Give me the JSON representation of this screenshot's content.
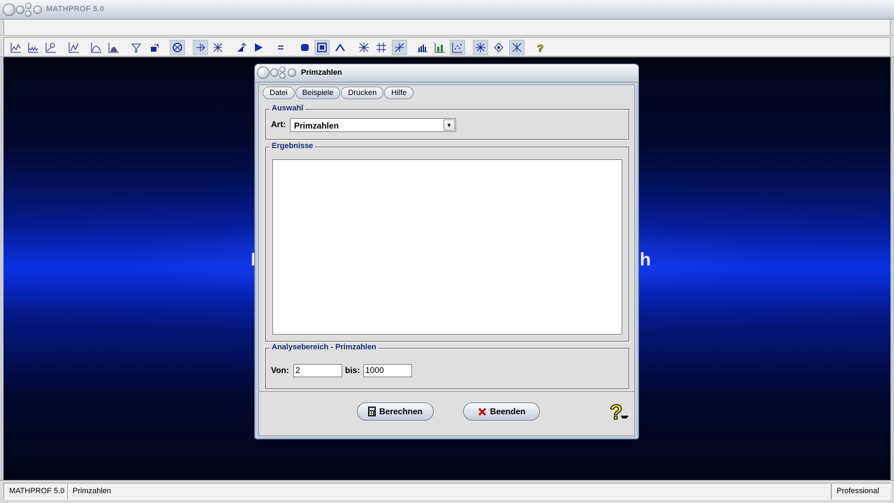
{
  "app": {
    "title": "MATHPROF 5.0"
  },
  "toolbar": {
    "icons": [
      "function-plot-icon",
      "multi-plot-icon",
      "curve-analysis-icon",
      "derivative-plot-icon",
      "integral-curve-icon",
      "area-plot-icon",
      "funnel-icon",
      "rotate-icon",
      "intersection-icon",
      "vector-arrow-icon",
      "grid-axes-icon",
      "export-icon",
      "play-icon",
      "equals-icon",
      "shape-icon",
      "frame-icon",
      "arch-icon",
      "star-grid-icon",
      "hash-grid-icon",
      "cross-diagonal-icon",
      "bar-chart-icon",
      "green-bar-chart-icon",
      "scatter-icon",
      "asterisk-icon",
      "diamond-icon",
      "asterisk-alt-icon",
      "help-icon"
    ]
  },
  "background": {
    "left_letter": "I",
    "right_letter": "h"
  },
  "dialog": {
    "title": "Primzahlen",
    "tabs": [
      {
        "label": "Datei"
      },
      {
        "label": "Beispiele"
      },
      {
        "label": "Drucken"
      },
      {
        "label": "Hilfe"
      }
    ],
    "selection_group": {
      "title": "Auswahl",
      "type_label": "Art:",
      "type_value": "Primzahlen"
    },
    "results_group": {
      "title": "Ergebnisse"
    },
    "range_group": {
      "title": "Analysebereich - Primzahlen",
      "from_label": "Von:",
      "from_value": "2",
      "to_label": "bis:",
      "to_value": "1000"
    },
    "buttons": {
      "calculate_label": "Berechnen",
      "quit_label": "Beenden"
    }
  },
  "statusbar": {
    "app_name": "MATHPROF 5.0",
    "module": "Primzahlen",
    "edition": "Professional"
  }
}
